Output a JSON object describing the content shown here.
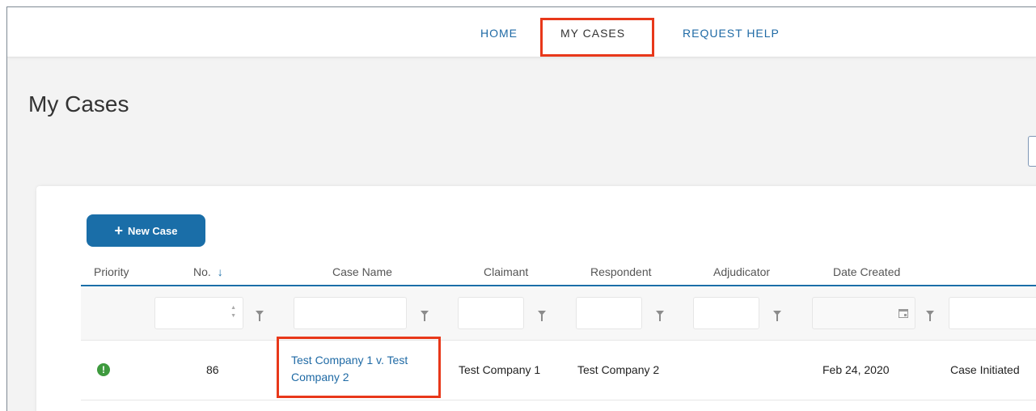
{
  "nav": {
    "home": "HOME",
    "my_cases": "MY CASES",
    "request_help": "REQUEST HELP"
  },
  "page": {
    "title": "My Cases"
  },
  "toolbar": {
    "new_case_label": "New Case",
    "new_case_icon": "plus-icon"
  },
  "table": {
    "columns": [
      "Priority",
      "No.",
      "Case Name",
      "Claimant",
      "Respondent",
      "Adjudicator",
      "Date Created"
    ],
    "sort": {
      "column": "No.",
      "direction": "descending"
    },
    "rows": [
      {
        "priority_icon": "exclamation-circle-icon",
        "no": "86",
        "case_name": "Test Company 1 v. Test Company 2",
        "claimant": "Test Company 1",
        "respondent": "Test Company 2",
        "adjudicator": "",
        "date_created": "Feb 24, 2020",
        "status": "Case Initiated"
      }
    ]
  },
  "colors": {
    "accent": "#1a6ea8",
    "link": "#1f6aa5",
    "highlight": "#e8381a",
    "priority": "#3e9a3e"
  }
}
